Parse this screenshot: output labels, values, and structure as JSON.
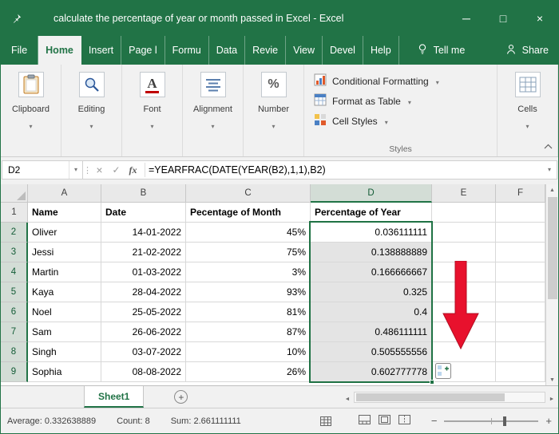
{
  "window": {
    "title": "calculate the percentage of year or month passed in Excel  -  Excel",
    "minimize": "─",
    "maximize": "□",
    "close": "×"
  },
  "ribbon": {
    "tabs": [
      {
        "label": "File",
        "active": false
      },
      {
        "label": "Home",
        "active": true
      },
      {
        "label": "Insert",
        "active": false
      },
      {
        "label": "Page l",
        "active": false
      },
      {
        "label": "Formu",
        "active": false
      },
      {
        "label": "Data",
        "active": false
      },
      {
        "label": "Revie",
        "active": false
      },
      {
        "label": "View",
        "active": false
      },
      {
        "label": "Devel",
        "active": false
      },
      {
        "label": "Help",
        "active": false
      }
    ],
    "tell_me": "Tell me",
    "share": "Share",
    "collapsed_groups": [
      "Clipboard",
      "Editing",
      "Font",
      "Alignment",
      "Number"
    ],
    "styles_items": [
      "Conditional Formatting",
      "Format as Table",
      "Cell Styles"
    ],
    "styles_label": "Styles",
    "cells_label": "Cells"
  },
  "formula_bar": {
    "name_box": "D2",
    "formula": "=YEARFRAC(DATE(YEAR(B2),1,1),B2)"
  },
  "grid": {
    "columns": [
      "A",
      "B",
      "C",
      "D",
      "E",
      "F"
    ],
    "rows": [
      {
        "n": "1",
        "cells": [
          "Name",
          "Date",
          "Pecentage of Month",
          "Percentage of Year",
          "",
          ""
        ]
      },
      {
        "n": "2",
        "cells": [
          "Oliver",
          "14-01-2022",
          "45%",
          "0.036111111",
          "",
          ""
        ]
      },
      {
        "n": "3",
        "cells": [
          "Jessi",
          "21-02-2022",
          "75%",
          "0.138888889",
          "",
          ""
        ]
      },
      {
        "n": "4",
        "cells": [
          "Martin",
          "01-03-2022",
          "3%",
          "0.166666667",
          "",
          ""
        ]
      },
      {
        "n": "5",
        "cells": [
          "Kaya",
          "28-04-2022",
          "93%",
          "0.325",
          "",
          ""
        ]
      },
      {
        "n": "6",
        "cells": [
          "Noel",
          "25-05-2022",
          "81%",
          "0.4",
          "",
          ""
        ]
      },
      {
        "n": "7",
        "cells": [
          "Sam",
          "26-06-2022",
          "87%",
          "0.486111111",
          "",
          ""
        ]
      },
      {
        "n": "8",
        "cells": [
          "Singh",
          "03-07-2022",
          "10%",
          "0.505555556",
          "",
          ""
        ]
      },
      {
        "n": "9",
        "cells": [
          "Sophia",
          "08-08-2022",
          "26%",
          "0.602777778",
          "",
          ""
        ]
      }
    ],
    "selection": {
      "column": "D",
      "first_row": 2,
      "last_row": 9,
      "active_cell": "D2"
    }
  },
  "sheet_tabs": {
    "active_sheet": "Sheet1",
    "new_sheet": "+"
  },
  "status_bar": {
    "average": "Average: 0.332638889",
    "count": "Count: 8",
    "sum": "Sum: 2.661111111"
  },
  "colors": {
    "accent_green": "#217346",
    "arrow_red": "#e8112d",
    "selection_fill": "#e4e4e4"
  }
}
